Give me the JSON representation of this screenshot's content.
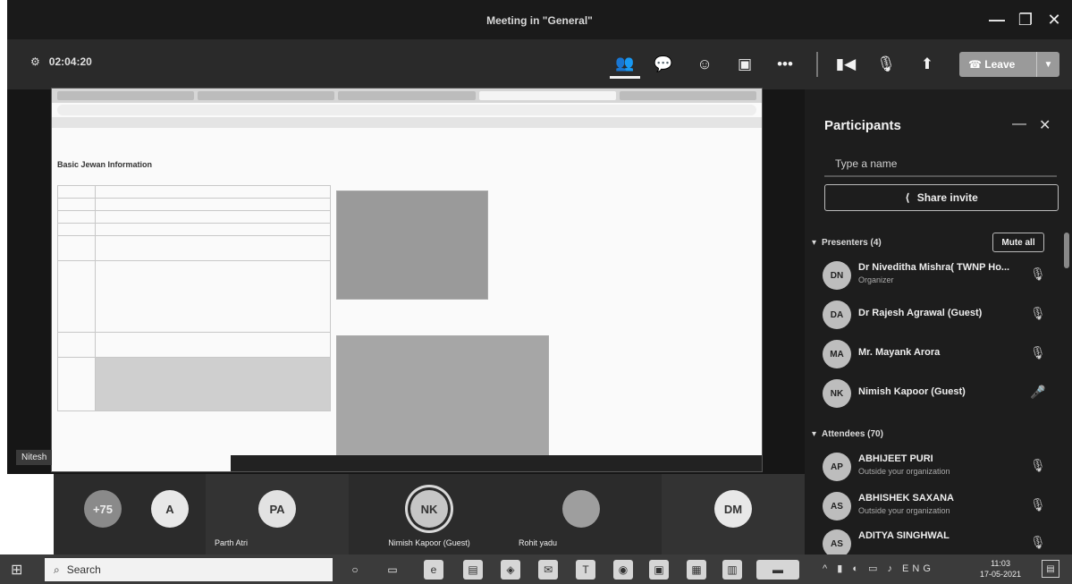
{
  "window": {
    "title": "Meeting in \"General\"",
    "controls": {
      "minimize": "—",
      "restore": "❐",
      "close": "✕"
    }
  },
  "toolbar": {
    "timer": "02:04:20",
    "icons": [
      "participants-icon",
      "chat-icon",
      "reactions-icon",
      "breakout-icon",
      "more-icon",
      "camera-off-icon",
      "mic-off-icon",
      "share-tray-icon"
    ],
    "leave_label": "Leave",
    "leave_color": "#9a9a9a"
  },
  "shared_screen": {
    "heading": "Basic Jewan Information",
    "presenter_label": "Nitesh"
  },
  "participants": {
    "title": "Participants",
    "search_placeholder": "Type a name",
    "share_invite_label": "Share invite",
    "presenters_header": "Presenters (4)",
    "attendees_header": "Attendees (70)",
    "mute_all_label": "Mute all",
    "presenters": [
      {
        "initials": "DN",
        "name": "Dr Niveditha Mishra( TWNP Ho...",
        "sub": "Organizer"
      },
      {
        "initials": "DA",
        "name": "Dr Rajesh Agrawal (Guest)",
        "sub": ""
      },
      {
        "initials": "MA",
        "name": "Mr. Mayank Arora",
        "sub": ""
      },
      {
        "initials": "NK",
        "name": "Nimish Kapoor (Guest)",
        "sub": ""
      }
    ],
    "attendees": [
      {
        "initials": "AP",
        "name": "ABHIJEET PURI",
        "sub": "Outside your organization"
      },
      {
        "initials": "AS",
        "name": "ABHISHEK SAXANA",
        "sub": "Outside your organization"
      },
      {
        "initials": "AS",
        "name": "ADITYA SINGHWAL",
        "sub": ""
      }
    ]
  },
  "gallery": {
    "tiles": [
      {
        "initials": "+75",
        "label": ""
      },
      {
        "initials": "A",
        "label": ""
      },
      {
        "initials": "PA",
        "label": "Parth Atri"
      },
      {
        "initials": "NK",
        "label": "Nimish Kapoor (Guest)"
      },
      {
        "initials": "",
        "label": "Rohit yadu"
      },
      {
        "initials": "DM",
        "label": ""
      }
    ]
  },
  "taskbar": {
    "search_label": "Search",
    "tray_text": "ENG",
    "time": "11:03",
    "date": "17-05-2021"
  }
}
